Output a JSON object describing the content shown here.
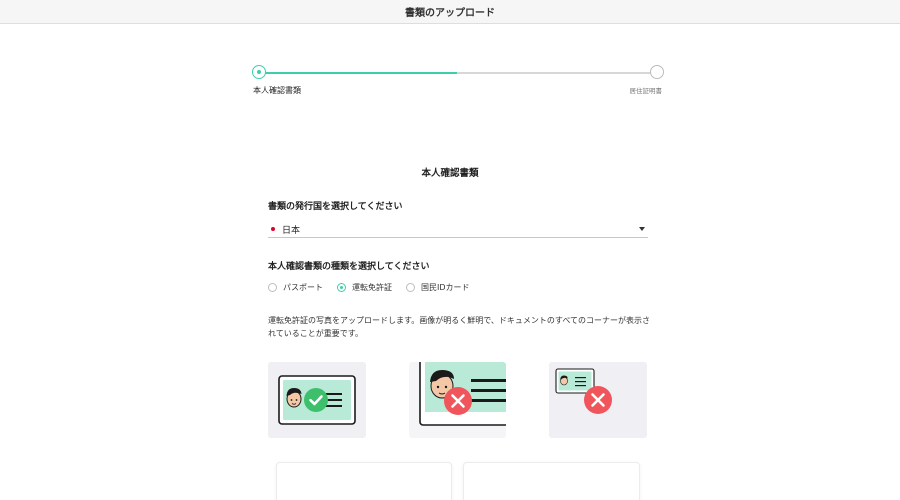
{
  "header": {
    "title": "書類のアップロード"
  },
  "stepper": {
    "current_step_label": "本人確認書類",
    "next_step_label": "居住証明書",
    "progress": 0.5
  },
  "form": {
    "section_title": "本人確認書類",
    "country_label": "書類の発行国を選択してください",
    "country_value": "日本",
    "doctype_label": "本人確認書類の種類を選択してください",
    "doctype_options": [
      {
        "label": "パスポート",
        "selected": false
      },
      {
        "label": "運転免許証",
        "selected": true
      },
      {
        "label": "国民IDカード",
        "selected": false
      }
    ],
    "instructions": "運転免許証の写真をアップロードします。画像が明るく鮮明で、ドキュメントのすべてのコーナーが表示されていることが重要です。"
  },
  "examples": [
    {
      "kind": "correct",
      "icon": "check-icon"
    },
    {
      "kind": "incorrect-cropped",
      "icon": "cross-icon"
    },
    {
      "kind": "incorrect-small",
      "icon": "cross-icon"
    }
  ],
  "colors": {
    "accent": "#3ccfaa",
    "success": "#3dbf6b",
    "error": "#f0555b",
    "card_bg": "#efeff4"
  }
}
